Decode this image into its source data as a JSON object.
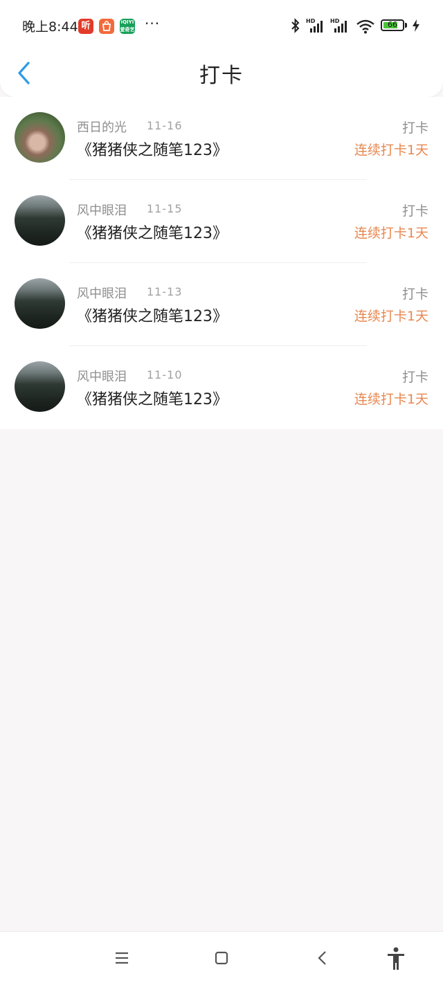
{
  "status_bar": {
    "time": "晚上8:44",
    "app_icons": [
      "ting-app-icon",
      "shopping-bag-app-icon",
      "iqiyi-app-icon"
    ],
    "ting_label": "听",
    "iqiyi_label": "iQIYI\n爱奇艺",
    "more": "···",
    "battery_level": "66",
    "battery_fraction": 0.66
  },
  "header": {
    "title": "打卡",
    "back_icon": "chevron-left-icon",
    "accent_color": "#2e9be5"
  },
  "checkins": [
    {
      "user": "西日的光",
      "date": "11-16",
      "book": "《猪猪侠之随笔123》",
      "tag": "打卡",
      "streak": "连续打卡1天",
      "avatar": "a"
    },
    {
      "user": "风中眼泪",
      "date": "11-15",
      "book": "《猪猪侠之随笔123》",
      "tag": "打卡",
      "streak": "连续打卡1天",
      "avatar": "b"
    },
    {
      "user": "风中眼泪",
      "date": "11-13",
      "book": "《猪猪侠之随笔123》",
      "tag": "打卡",
      "streak": "连续打卡1天",
      "avatar": "b"
    },
    {
      "user": "风中眼泪",
      "date": "11-10",
      "book": "《猪猪侠之随笔123》",
      "tag": "打卡",
      "streak": "连续打卡1天",
      "avatar": "b"
    }
  ],
  "colors": {
    "streak": "#e8874f",
    "secondary_text": "#8f8f8f",
    "page_background": "#f8f6f7"
  },
  "system_nav": [
    "menu-icon",
    "home-icon",
    "back-icon",
    "accessibility-icon"
  ]
}
